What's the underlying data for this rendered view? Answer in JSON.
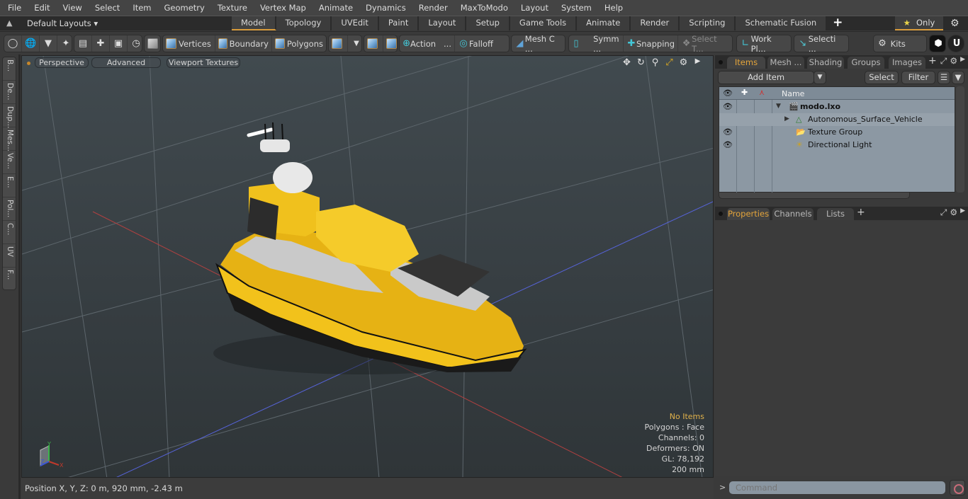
{
  "menu": [
    "File",
    "Edit",
    "View",
    "Select",
    "Item",
    "Geometry",
    "Texture",
    "Vertex Map",
    "Animate",
    "Dynamics",
    "Render",
    "MaxToModo",
    "Layout",
    "System",
    "Help"
  ],
  "layout_bar": {
    "layouts_label": "Default Layouts",
    "tabs": [
      "Model",
      "Topology",
      "UVEdit",
      "Paint",
      "Layout",
      "Setup",
      "Game Tools",
      "Animate",
      "Render",
      "Scripting",
      "Schematic Fusion"
    ],
    "active_tab": "Model",
    "add_tab": "+",
    "only_label": "Only"
  },
  "toolbar": {
    "vertices": "Vertices",
    "boundary": "Boundary",
    "polygons": "Polygons",
    "action": "Action",
    "action_more": "...",
    "falloff": "Falloff",
    "mesh_c": "Mesh C ...",
    "symm": "Symm ...",
    "snapping": "Snapping",
    "select_t": "Select T...",
    "work_pl": "Work Pl...",
    "selecti": "Selecti ...",
    "kits": "Kits"
  },
  "left_tabs": [
    "B...",
    "De...",
    "Dup...",
    "Mes...",
    "Ve...",
    "E...",
    "Pol...",
    "C...",
    "UV",
    "F..."
  ],
  "viewport": {
    "view_mode": "Perspective",
    "shading": "Advanced",
    "textures": "Viewport Textures",
    "info": {
      "selection": "No Items",
      "polygons": "Polygons : Face",
      "channels": "Channels: 0",
      "deformers": "Deformers: ON",
      "gl": "GL: 78,192",
      "scale": "200 mm"
    },
    "axis_labels": {
      "x": "X",
      "y": "Y",
      "z": "Z"
    }
  },
  "status": {
    "position": "Position X, Y, Z:   0 m, 920 mm, -2.43 m"
  },
  "items_panel": {
    "tabs": [
      "Items",
      "Mesh ...",
      "Shading",
      "Groups",
      "Images"
    ],
    "active_tab": "Items",
    "add_item": "Add Item",
    "select": "Select",
    "filter": "Filter",
    "column_name": "Name",
    "tree": [
      {
        "name": "modo.lxo",
        "visible": true,
        "bold": true,
        "expanded": true,
        "icon": "scene-icon",
        "depth": 0
      },
      {
        "name": "Autonomous_Surface_Vehicle",
        "visible": false,
        "bold": false,
        "expanded": false,
        "icon": "locator-icon",
        "depth": 1
      },
      {
        "name": "Texture Group",
        "visible": true,
        "bold": false,
        "icon": "folder-icon",
        "depth": 1
      },
      {
        "name": "Directional Light",
        "visible": true,
        "bold": false,
        "icon": "light-icon",
        "depth": 1
      }
    ]
  },
  "properties_panel": {
    "tabs": [
      "Properties",
      "Channels",
      "Lists"
    ],
    "active_tab": "Properties"
  },
  "command": {
    "prompt": ">",
    "placeholder": "Command"
  },
  "colors": {
    "accent": "#d79a3a",
    "active_tab_text": "#e3a43b",
    "info_highlight": "#e2b24b",
    "boat_yellow": "#f2c21b",
    "axis_x": "#c0392b",
    "axis_y": "#3bb54a",
    "axis_z": "#3a55d6"
  }
}
